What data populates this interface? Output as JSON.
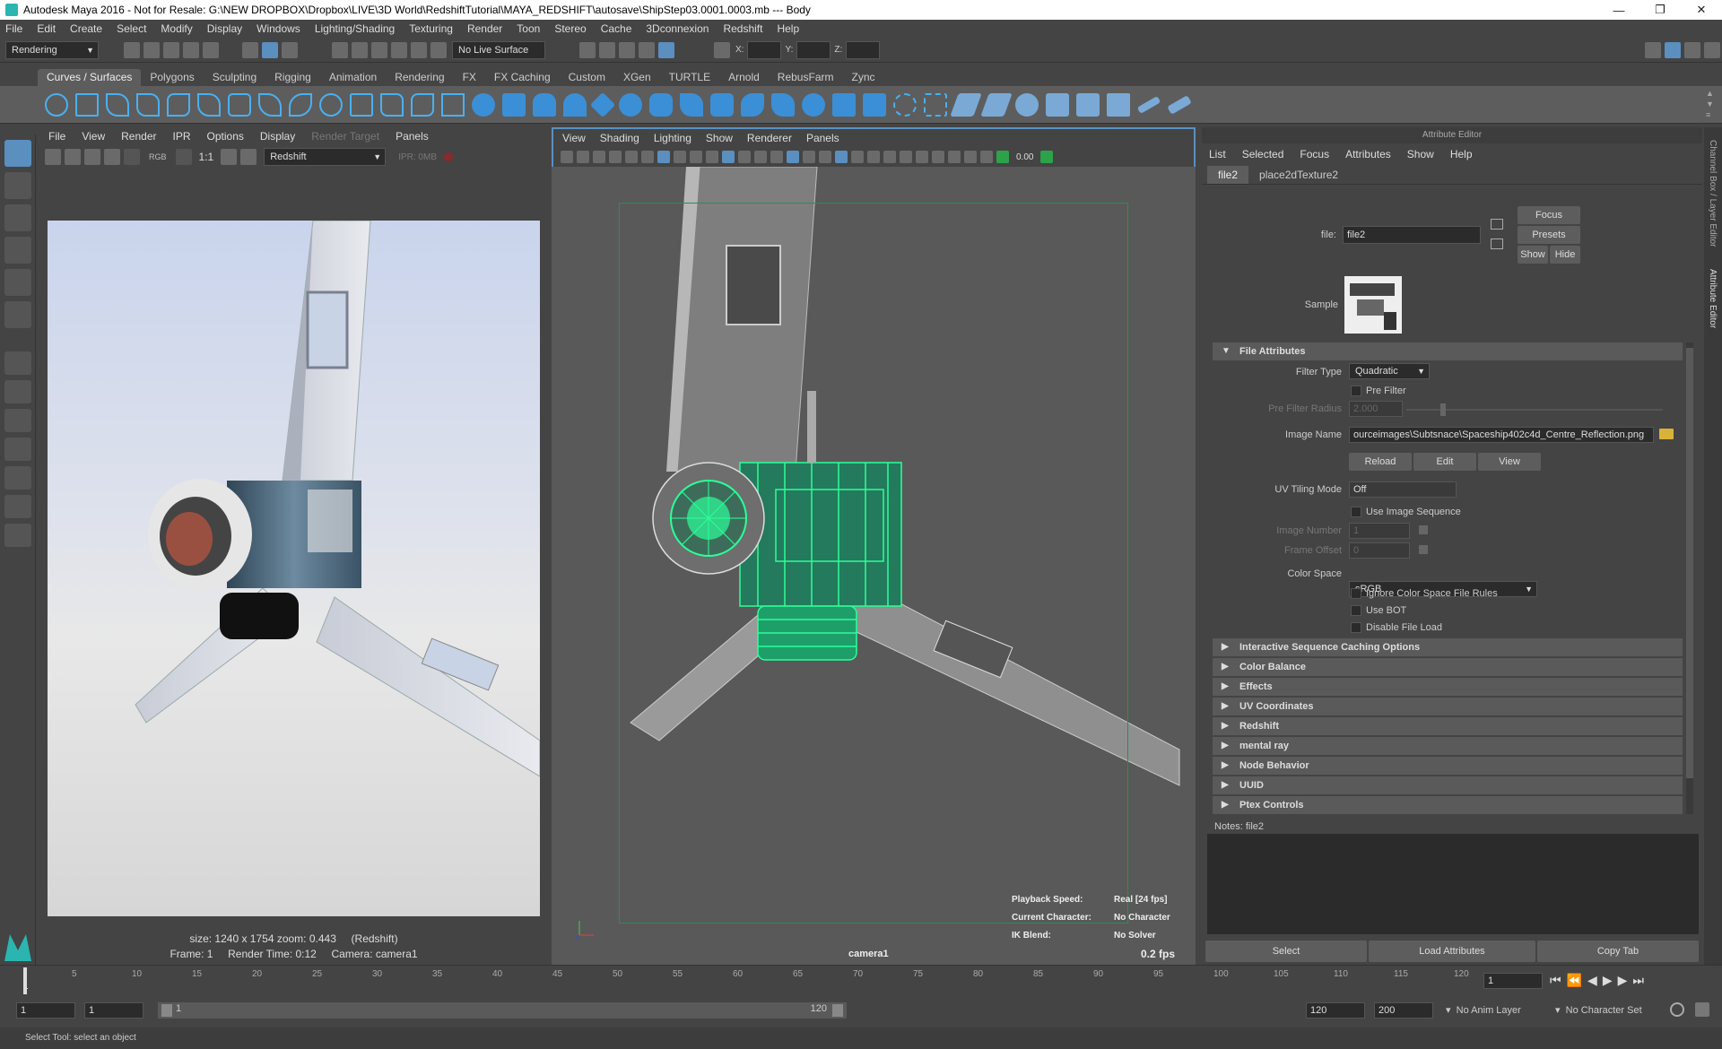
{
  "window": {
    "title": "Autodesk Maya 2016 - Not for Resale: G:\\NEW DROPBOX\\Dropbox\\LIVE\\3D World\\RedshiftTutorial\\MAYA_REDSHIFT\\autosave\\ShipStep03.0001.0003.mb  ---  Body",
    "minimize": "—",
    "restore": "❐",
    "close": "✕"
  },
  "menubar": [
    "File",
    "Edit",
    "Create",
    "Select",
    "Modify",
    "Display",
    "Windows",
    "Lighting/Shading",
    "Texturing",
    "Render",
    "Toon",
    "Stereo",
    "Cache",
    "3Dconnexion",
    "Redshift",
    "Help"
  ],
  "statusline": {
    "menuset": "Rendering",
    "live_surface": "No Live Surface",
    "x_label": "X:",
    "y_label": "Y:",
    "z_label": "Z:"
  },
  "shelf_tabs": [
    "Curves / Surfaces",
    "Polygons",
    "Sculpting",
    "Rigging",
    "Animation",
    "Rendering",
    "FX",
    "FX Caching",
    "Custom",
    "XGen",
    "TURTLE",
    "Arnold",
    "RebusFarm",
    "Zync"
  ],
  "render_view": {
    "menu": [
      "File",
      "View",
      "Render",
      "IPR",
      "Options",
      "Display",
      "Render Target",
      "Panels"
    ],
    "rgb_label": "RGB",
    "ratio": "1:1",
    "renderer": "Redshift",
    "ipr_mem": "IPR: 0MB",
    "info_line1_size": "size: 1240 x 1754 zoom: 0.443",
    "info_line1_renderer": "(Redshift)",
    "frame": "Frame: 1",
    "render_time": "Render Time: 0:12",
    "camera": "Camera: camera1"
  },
  "viewport": {
    "menu": [
      "View",
      "Shading",
      "Lighting",
      "Show",
      "Renderer",
      "Panels"
    ],
    "field_value": "0.00",
    "hud": {
      "playback_label": "Playback Speed:",
      "playback_value": "Real [24 fps]",
      "character_label": "Current Character:",
      "character_value": "No Character",
      "ik_label": "IK Blend:",
      "ik_value": "No Solver"
    },
    "camera": "camera1",
    "fps": "0.2 fps"
  },
  "attribute_editor": {
    "header": "Attribute Editor",
    "menu": [
      "List",
      "Selected",
      "Focus",
      "Attributes",
      "Show",
      "Help"
    ],
    "tabs": [
      "file2",
      "place2dTexture2"
    ],
    "file_label": "file:",
    "file_value": "file2",
    "focus": "Focus",
    "presets": "Presets",
    "show": "Show",
    "hide": "Hide",
    "sample_label": "Sample",
    "file_attributes": "File Attributes",
    "filter_type_label": "Filter Type",
    "filter_type": "Quadratic",
    "pre_filter": "Pre Filter",
    "pre_filter_radius_label": "Pre Filter Radius",
    "pre_filter_radius": "2.000",
    "image_name_label": "Image Name",
    "image_name": "ourceimages\\Subtsnace\\Spaceship402c4d_Centre_Reflection.png",
    "reload": "Reload",
    "edit": "Edit",
    "view": "View",
    "uv_tiling_label": "UV Tiling Mode",
    "uv_tiling": "Off",
    "use_image_sequence": "Use Image Sequence",
    "image_number_label": "Image Number",
    "image_number": "1",
    "frame_offset_label": "Frame Offset",
    "frame_offset": "0",
    "color_space_label": "Color Space",
    "color_space": "sRGB",
    "ignore_rules": "Ignore Color Space File Rules",
    "use_bot": "Use BOT",
    "disable_load": "Disable File Load",
    "sections": [
      "Interactive Sequence Caching Options",
      "Color Balance",
      "Effects",
      "UV Coordinates",
      "Redshift",
      "mental ray",
      "Node Behavior",
      "UUID",
      "Ptex Controls"
    ],
    "notes": "Notes:  file2",
    "select": "Select",
    "load_attributes": "Load Attributes",
    "copy_tab": "Copy Tab"
  },
  "side_tabs": [
    "Channel Box / Layer Editor",
    "Attribute Editor"
  ],
  "timeline": {
    "ticks": [
      "5",
      "10",
      "15",
      "20",
      "25",
      "30",
      "35",
      "40",
      "45",
      "50",
      "55",
      "60",
      "65",
      "70",
      "75",
      "80",
      "85",
      "90",
      "95",
      "100",
      "105",
      "110",
      "115",
      "120"
    ],
    "start_tick": "1",
    "current_frame": "1"
  },
  "range": {
    "start": "1",
    "playback_start": "1",
    "range_start": "1",
    "range_end": "120",
    "end": "120",
    "anim_end": "200",
    "anim_layer": "No Anim Layer",
    "char_set": "No Character Set"
  },
  "help_line": "Select Tool: select an object",
  "colors": {
    "accent": "#5a8fbf",
    "wire": "#2cff9a",
    "bg": "#444444"
  }
}
